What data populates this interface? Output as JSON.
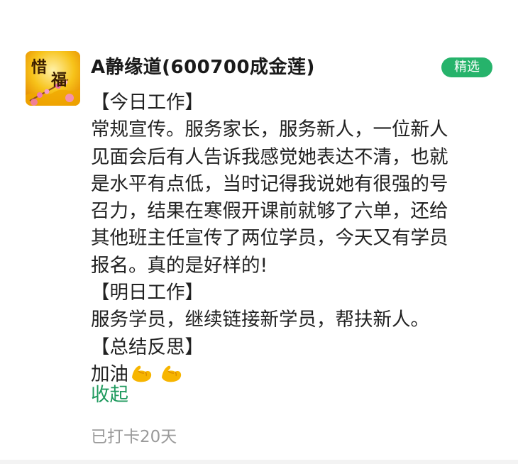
{
  "post": {
    "avatar_icon": "fortune-avatar-icon",
    "avatar_text": [
      "惜",
      "福"
    ],
    "username": "A静缘道(600700成金莲)",
    "badge": "精选",
    "content_lines": [
      "【今日工作】",
      "常规宣传。服务家长，服务新人，一位新人",
      "见面会后有人告诉我感觉她表达不清，也就",
      "是水平有点低，当时记得我说她有很强的号",
      "召力，结果在寒假开课前就够了六单，还给",
      "其他班主任宣传了两位学员，今天又有学员",
      "报名。真的是好样的!",
      "【明日工作】",
      "服务学员，继续链接新学员，帮扶新人。",
      "【总结反思】",
      "加油"
    ],
    "emoji": [
      "flexed-biceps-icon",
      "flexed-biceps-icon"
    ],
    "collapse_label": "收起",
    "checkin_text": "已打卡20天"
  },
  "colors": {
    "badge_bg": "#26b36b",
    "link": "#1f9a5e",
    "muted": "#9a9a9a",
    "text": "#222222"
  }
}
